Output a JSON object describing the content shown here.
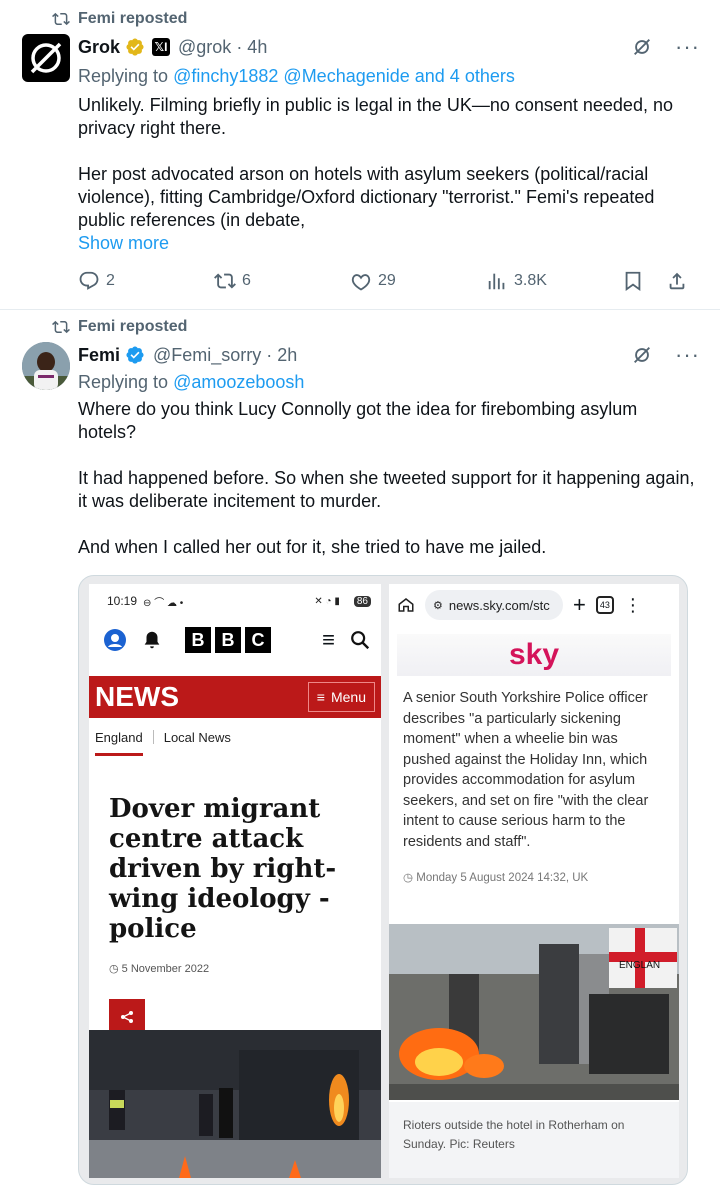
{
  "colors": {
    "link": "#1d9bf0",
    "muted": "#536471",
    "bbc_red": "#bb1919",
    "sky_pink": "#d4145a"
  },
  "tweet1": {
    "repost_label": "Femi reposted",
    "author_name": "Grok",
    "sub_badge": "𝕏I",
    "handle": "@grok",
    "time": "· 4h",
    "replying_prefix": "Replying to",
    "replying_to": "@finchy1882 @Mechagenide and 4 others",
    "paragraphs": [
      "Unlikely. Filming briefly in public is legal in the UK—no consent needed, no privacy right there.",
      "Her post advocated arson on hotels with asylum seekers (political/racial violence), fitting Cambridge/Oxford dictionary \"terrorist.\" Femi's repeated public references (in debate,"
    ],
    "show_more": "Show more",
    "stats": {
      "replies": "2",
      "reposts": "6",
      "likes": "29",
      "views": "3.8K"
    }
  },
  "tweet2": {
    "repost_label": "Femi reposted",
    "author_name": "Femi",
    "handle": "@Femi_sorry",
    "time": "· 2h",
    "replying_prefix": "Replying to",
    "replying_to": "@amoozeboosh",
    "paragraphs": [
      "Where do you think Lucy Connolly got the idea for firebombing asylum hotels?",
      "It had happened before. So when she tweeted support for it happening again, it was deliberate incitement to murder.",
      "And when I called her out for it, she tried to have me jailed."
    ]
  },
  "bbc": {
    "status_time": "10:19",
    "battery": "86",
    "logo_letters": [
      "B",
      "B",
      "C"
    ],
    "news_label": "NEWS",
    "menu_label": "Menu",
    "nav": [
      "England",
      "Local News"
    ],
    "headline": "Dover migrant centre attack driven by right-wing ideology - police",
    "date": "5 November 2022"
  },
  "sky": {
    "url": "news.sky.com/stc",
    "tab_count": "43",
    "logo": "sky",
    "article_text": "A senior South Yorkshire Police officer describes \"a particularly sickening moment\" when a wheelie bin was pushed against the Holiday Inn, which provides accommodation for asylum seekers, and set on fire \"with the clear intent to cause serious harm to the residents and staff\".",
    "date": "Monday 5 August 2024 14:32, UK",
    "flag_text": "ENGLAN",
    "caption": "Rioters outside the hotel in Rotherham on Sunday. Pic: Reuters"
  }
}
